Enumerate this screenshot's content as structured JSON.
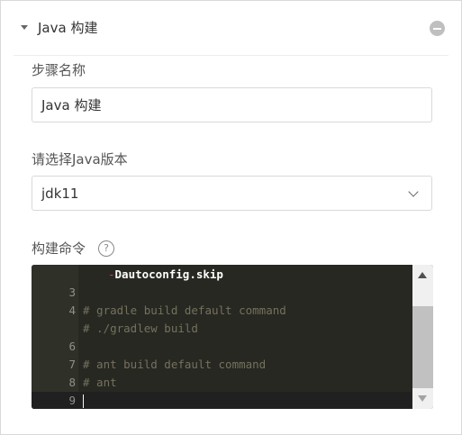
{
  "step": {
    "title": "Java 构建",
    "collapse_icon": "caret-down-icon",
    "remove_icon": "minus-circle-icon"
  },
  "fields": {
    "step_name": {
      "label": "步骤名称",
      "value": "Java 构建"
    },
    "java_version": {
      "label": "请选择Java版本",
      "value": "jdk11",
      "icon": "chevron-down-icon"
    },
    "build_command": {
      "label": "构建命令",
      "help_icon": "question-circle-icon",
      "help_glyph": "?",
      "lines": [
        {
          "number": "",
          "dash": "-",
          "text": "Dautoconfig.skip"
        },
        {
          "number": "3",
          "text": ""
        },
        {
          "number": "4",
          "text": "# gradle build default command"
        },
        {
          "number": "",
          "text": "# ./gradlew build"
        },
        {
          "number": "6",
          "text": ""
        },
        {
          "number": "7",
          "text": "# ant build default command"
        },
        {
          "number": "8",
          "text": "# ant"
        },
        {
          "number": "9",
          "text": ""
        }
      ]
    }
  },
  "colors": {
    "editor_background": "#272822",
    "comment": "#75715e",
    "flag_dash": "#f92672",
    "gutter_text": "#8f908a"
  }
}
